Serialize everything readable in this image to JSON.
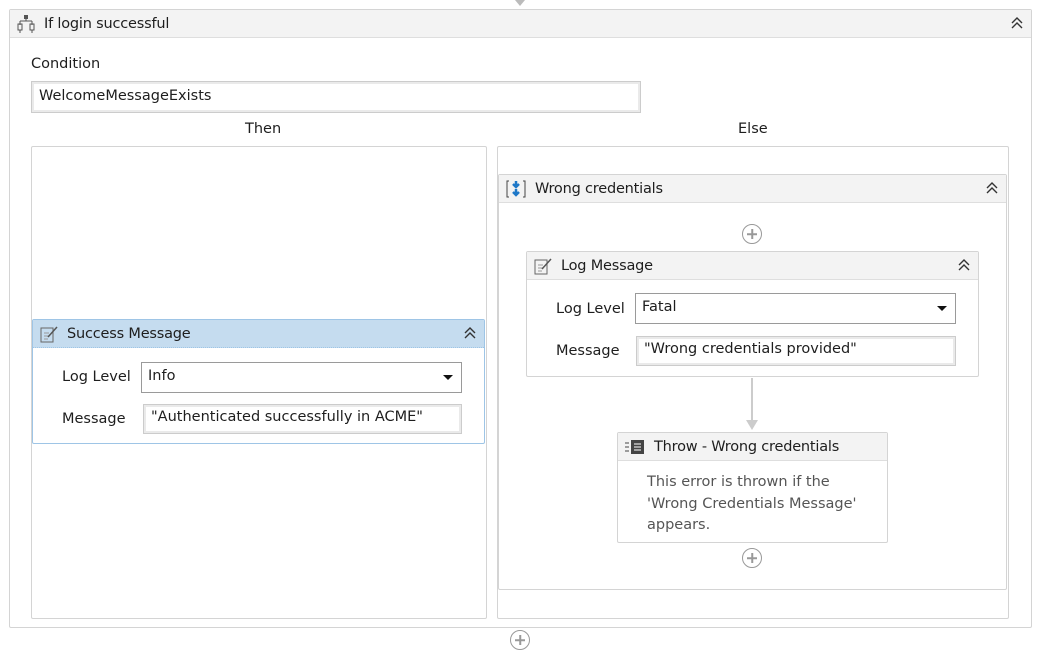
{
  "if_activity": {
    "title": "If login successful",
    "icon": "if-branch-icon",
    "condition_label": "Condition",
    "condition_value": "WelcomeMessageExists",
    "then_label": "Then",
    "else_label": "Else"
  },
  "success_message": {
    "title": "Success Message",
    "icon": "log-message-icon",
    "log_level_label": "Log Level",
    "log_level_value": "Info",
    "message_label": "Message",
    "message_value": "\"Authenticated successfully in ACME\""
  },
  "sequence": {
    "title": "Wrong credentials",
    "icon": "sequence-icon"
  },
  "log_message": {
    "title": "Log Message",
    "icon": "log-message-icon",
    "log_level_label": "Log Level",
    "log_level_value": "Fatal",
    "message_label": "Message",
    "message_value": "\"Wrong credentials provided\""
  },
  "throw": {
    "title": "Throw - Wrong credentials",
    "icon": "throw-icon",
    "annotation": "This error is thrown if the 'Wrong Credentials Message' appears."
  },
  "colors": {
    "selected_header": "#c5dcef",
    "selected_border": "#9ec5e6",
    "header_bg": "#f3f3f3"
  }
}
